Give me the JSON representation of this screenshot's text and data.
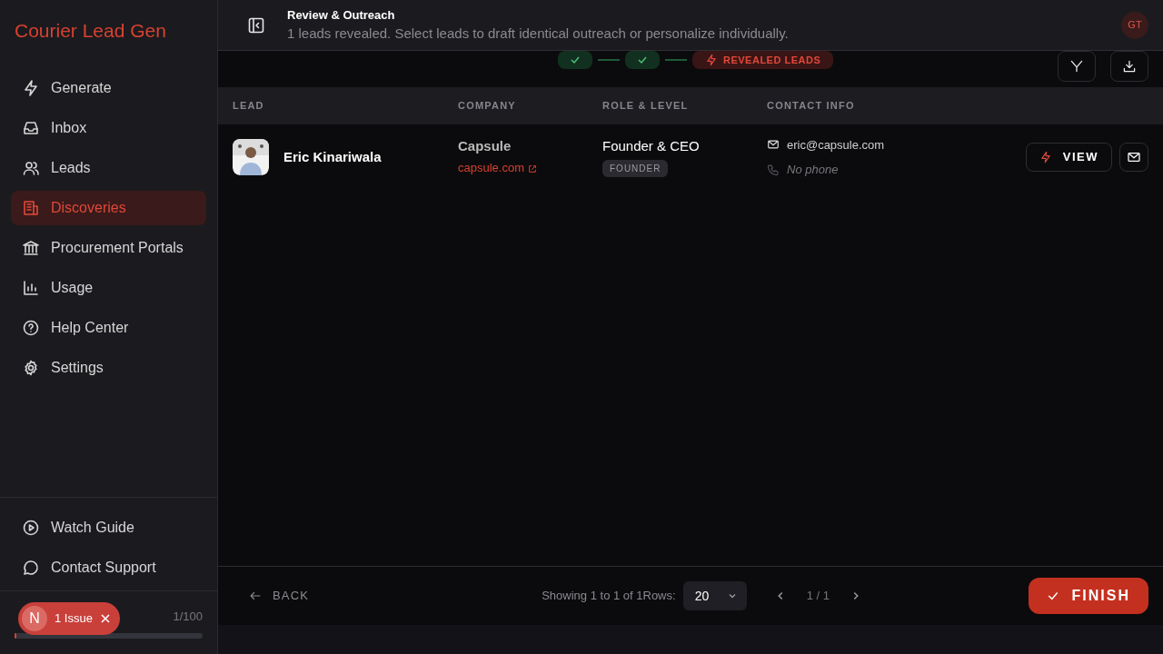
{
  "sidebar": {
    "brand": "Courier Lead Gen",
    "items": [
      {
        "label": "Generate",
        "selected": false
      },
      {
        "label": "Inbox",
        "selected": false
      },
      {
        "label": "Leads",
        "selected": false
      },
      {
        "label": "Discoveries",
        "selected": true
      },
      {
        "label": "Procurement Portals",
        "selected": false
      },
      {
        "label": "Usage",
        "selected": false
      },
      {
        "label": "Help Center",
        "selected": false
      },
      {
        "label": "Settings",
        "selected": false
      }
    ],
    "bottom_items": [
      {
        "label": "Watch Guide"
      },
      {
        "label": "Contact Support"
      }
    ],
    "usage": {
      "reading": "1/100",
      "level": 0.01
    },
    "issue_toast": {
      "avatar": "N",
      "label": "1 Issue"
    }
  },
  "header": {
    "title": "Review & Outreach",
    "subtitle": "1 leads revealed. Select leads to draft identical outreach or personalize individually.",
    "avatar": "GT"
  },
  "steps": [
    {
      "done": true
    },
    {
      "done": true
    },
    {
      "done": false,
      "label": "REVEALED LEADS"
    }
  ],
  "table": {
    "columns": [
      "LEAD",
      "COMPANY",
      "ROLE & LEVEL",
      "CONTACT INFO"
    ],
    "rows": [
      {
        "name": "Eric Kinariwala",
        "company": "Capsule",
        "website": "capsule.com",
        "role": "Founder & CEO",
        "level": "FOUNDER",
        "email": "eric@capsule.com",
        "phone": "No phone",
        "action": "VIEW"
      }
    ]
  },
  "footer": {
    "back": "BACK",
    "showing": "Showing 1 to 1 of 1Rows:",
    "page_size": "20",
    "page": "1 / 1",
    "finish": "FINISH"
  }
}
